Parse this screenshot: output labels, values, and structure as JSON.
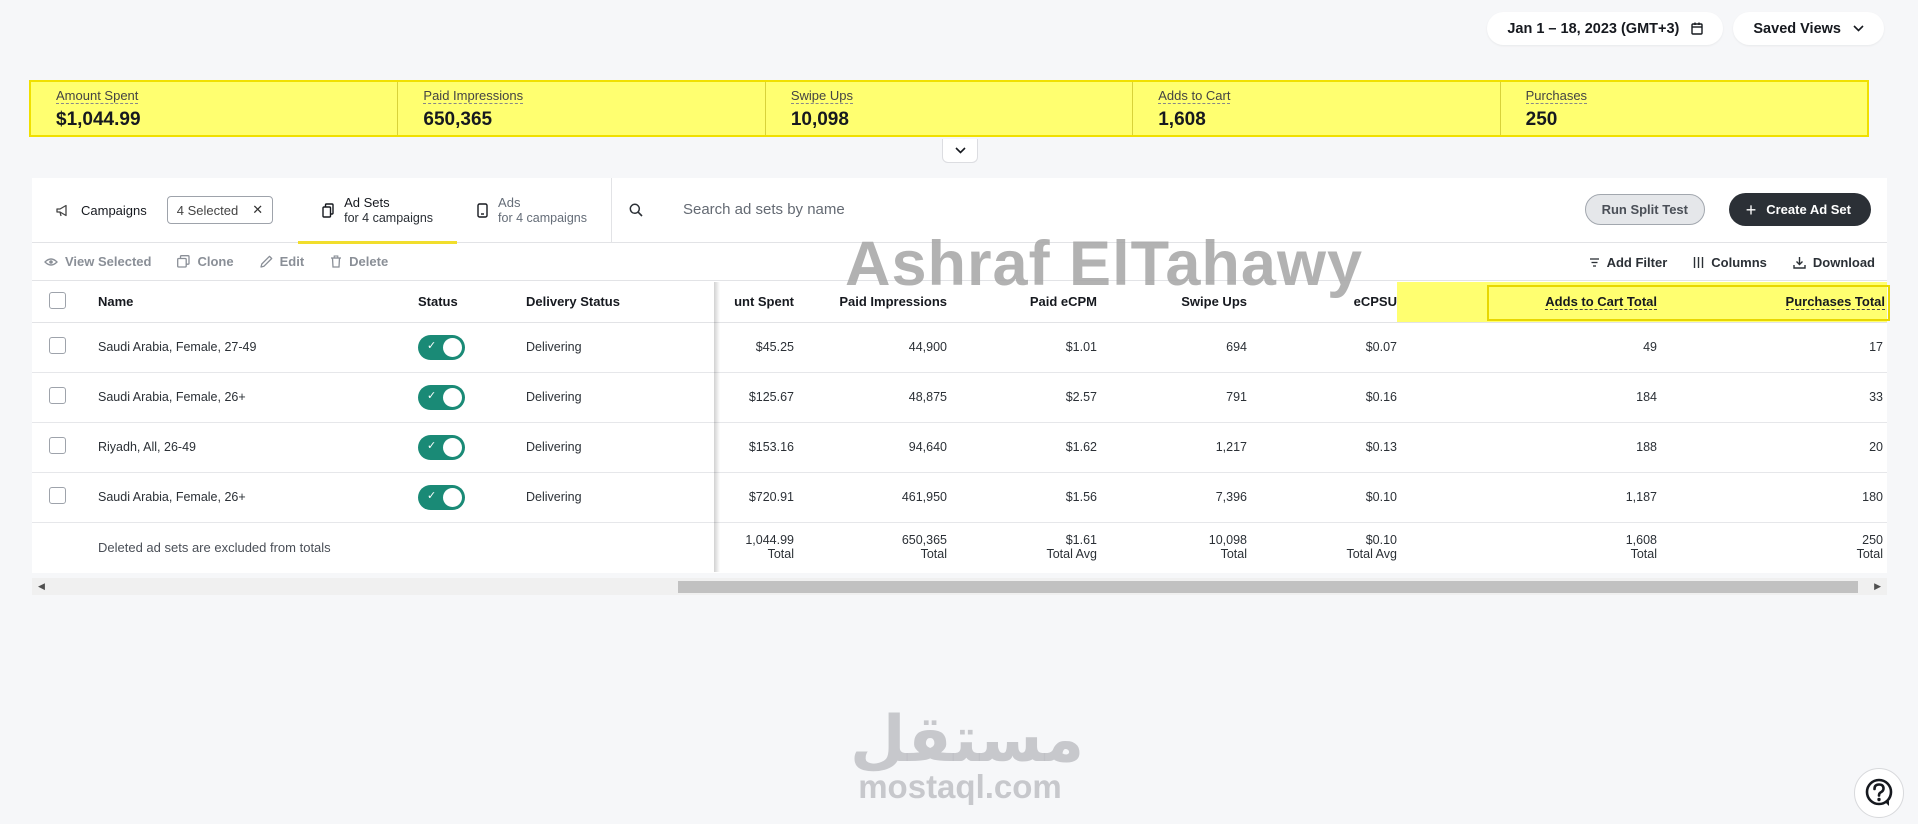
{
  "header": {
    "date_range": "Jan 1 – 18, 2023 (GMT+3)",
    "saved_views": "Saved Views"
  },
  "metrics": [
    {
      "label": "Amount Spent",
      "value": "$1,044.99"
    },
    {
      "label": "Paid Impressions",
      "value": "650,365"
    },
    {
      "label": "Swipe Ups",
      "value": "10,098"
    },
    {
      "label": "Adds to Cart",
      "value": "1,608"
    },
    {
      "label": "Purchases",
      "value": "250"
    }
  ],
  "nav": {
    "campaigns": "Campaigns",
    "selected_chip": "4 Selected",
    "adsets_title": "Ad Sets",
    "adsets_sub": "for 4 campaigns",
    "ads_title": "Ads",
    "ads_sub": "for 4 campaigns",
    "search_placeholder": "Search ad sets by name",
    "run_split": "Run Split Test",
    "create": "Create Ad Set"
  },
  "actions": {
    "view_selected": "View Selected",
    "clone": "Clone",
    "edit": "Edit",
    "delete": "Delete",
    "add_filter": "Add Filter",
    "columns": "Columns",
    "download": "Download"
  },
  "table": {
    "headers": {
      "name": "Name",
      "status": "Status",
      "delivery": "Delivery Status",
      "amount": "unt Spent",
      "impressions": "Paid Impressions",
      "ecpm": "Paid eCPM",
      "swipe": "Swipe Ups",
      "ecpsu": "eCPSU",
      "atc": "Adds to Cart Total",
      "purchases": "Purchases Total"
    },
    "rows": [
      {
        "name": "Saudi Arabia, Female, 27-49",
        "delivery": "Delivering",
        "amount": "$45.25",
        "impressions": "44,900",
        "ecpm": "$1.01",
        "swipe": "694",
        "ecpsu": "$0.07",
        "atc": "49",
        "purchases": "17"
      },
      {
        "name": "Saudi Arabia, Female, 26+",
        "delivery": "Delivering",
        "amount": "$125.67",
        "impressions": "48,875",
        "ecpm": "$2.57",
        "swipe": "791",
        "ecpsu": "$0.16",
        "atc": "184",
        "purchases": "33"
      },
      {
        "name": "Riyadh, All, 26-49",
        "delivery": "Delivering",
        "amount": "$153.16",
        "impressions": "94,640",
        "ecpm": "$1.62",
        "swipe": "1,217",
        "ecpsu": "$0.13",
        "atc": "188",
        "purchases": "20"
      },
      {
        "name": "Saudi Arabia, Female, 26+",
        "delivery": "Delivering",
        "amount": "$720.91",
        "impressions": "461,950",
        "ecpm": "$1.56",
        "swipe": "7,396",
        "ecpsu": "$0.10",
        "atc": "1,187",
        "purchases": "180"
      }
    ],
    "totals": {
      "note": "Deleted ad sets are excluded from totals",
      "amount": "1,044.99",
      "amount_l": "Total",
      "impressions": "650,365",
      "impressions_l": "Total",
      "ecpm": "$1.61",
      "ecpm_l": "Total Avg",
      "swipe": "10,098",
      "swipe_l": "Total",
      "ecpsu": "$0.10",
      "ecpsu_l": "Total Avg",
      "atc": "1,608",
      "atc_l": "Total",
      "purchases": "250",
      "purchases_l": "Total"
    }
  },
  "watermarks": {
    "name": "Ashraf ElTahawy",
    "logo_ar": "مستقل",
    "logo_en": "mostaql.com"
  },
  "colors": {
    "highlight": "#ffff70",
    "toggle_on": "#1a8a76",
    "create_btn": "#2b3036"
  }
}
